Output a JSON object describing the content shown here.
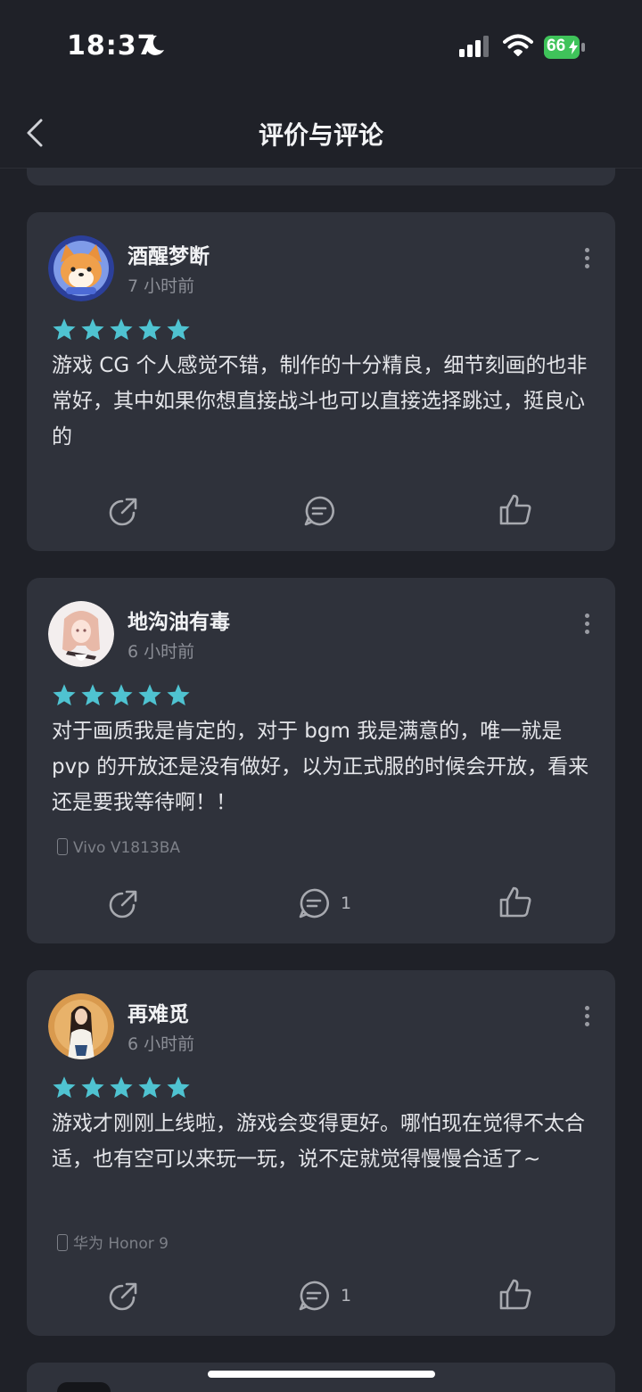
{
  "status_bar": {
    "time": "18:37",
    "battery": "66"
  },
  "nav": {
    "title": "评价与评论"
  },
  "reviews": [
    {
      "username": "酒醒梦断",
      "time_ago": "7 小时前",
      "rating": 5,
      "content": "游戏 CG 个人感觉不错，制作的十分精良，细节刻画的也非常好，其中如果你想直接战斗也可以直接选择跳过，挺良心的",
      "device": "",
      "comment_count": ""
    },
    {
      "username": "地沟油有毒",
      "time_ago": "6 小时前",
      "rating": 5,
      "content": "对于画质我是肯定的，对于 bgm 我是满意的，唯一就是 pvp 的开放还是没有做好，以为正式服的时候会开放，看来还是要我等待啊！！",
      "device": "Vivo V1813BA",
      "comment_count": "1"
    },
    {
      "username": "再难觅",
      "time_ago": "6 小时前",
      "rating": 5,
      "content": "游戏才刚刚上线啦，游戏会变得更好。哪怕现在觉得不太合适，也有空可以来玩一玩，说不定就觉得慢慢合适了~",
      "device": "华为 Honor 9",
      "comment_count": "1"
    }
  ],
  "colors": {
    "star": "#4fc3d1",
    "card": "#2f323b",
    "background": "#1f2128"
  }
}
